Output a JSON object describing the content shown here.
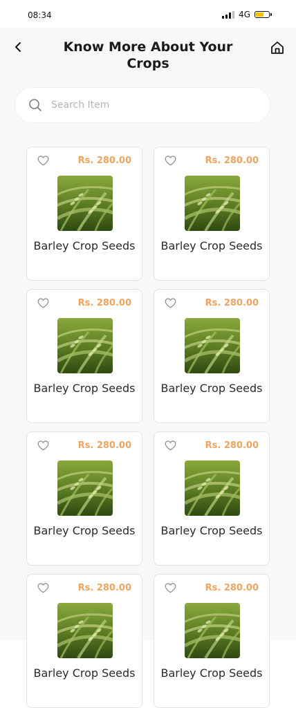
{
  "status_bar": {
    "time": "08:34",
    "network": "4G",
    "battery_level": 0.55,
    "battery_color": "#f2c200"
  },
  "header": {
    "title": "Know More About Your Crops",
    "back_icon": "chevron-left-icon",
    "home_icon": "home-icon"
  },
  "search": {
    "placeholder": "Search Item",
    "value": "",
    "icon": "search-icon"
  },
  "colors": {
    "price": "#f0a35e",
    "background": "#f8f8f8",
    "card_border": "#e3e3e3"
  },
  "products": [
    {
      "price": "Rs. 280.00",
      "name": "Barley Crop Seeds",
      "favorite_icon": "heart-outline-icon"
    },
    {
      "price": "Rs. 280.00",
      "name": "Barley Crop Seeds",
      "favorite_icon": "heart-outline-icon"
    },
    {
      "price": "Rs. 280.00",
      "name": "Barley Crop Seeds",
      "favorite_icon": "heart-outline-icon"
    },
    {
      "price": "Rs. 280.00",
      "name": "Barley Crop Seeds",
      "favorite_icon": "heart-outline-icon"
    },
    {
      "price": "Rs. 280.00",
      "name": "Barley Crop Seeds",
      "favorite_icon": "heart-outline-icon"
    },
    {
      "price": "Rs. 280.00",
      "name": "Barley Crop Seeds",
      "favorite_icon": "heart-outline-icon"
    },
    {
      "price": "Rs. 280.00",
      "name": "Barley Crop Seeds",
      "favorite_icon": "heart-outline-icon"
    },
    {
      "price": "Rs. 280.00",
      "name": "Barley Crop Seeds",
      "favorite_icon": "heart-outline-icon"
    }
  ]
}
